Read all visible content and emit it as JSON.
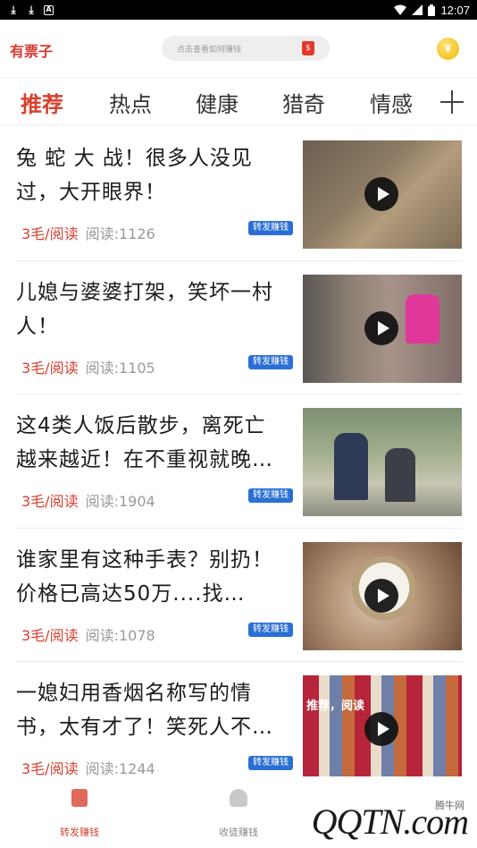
{
  "status_bar": {
    "icons": [
      "download-icon",
      "download-icon",
      "app-notification-icon",
      "wifi-icon",
      "signal-icon",
      "battery-icon"
    ],
    "time": "12:07"
  },
  "header": {
    "brand": "有票子",
    "search_placeholder": "点击查看如何赚钱",
    "coin_symbol": "¥"
  },
  "tabs": [
    {
      "label": "推荐",
      "active": true
    },
    {
      "label": "热点"
    },
    {
      "label": "健康"
    },
    {
      "label": "猎奇"
    },
    {
      "label": "情感"
    }
  ],
  "feed": [
    {
      "title": "兔 蛇 大 战！很多人没见过，大开眼界！",
      "reward": "3毛/阅读",
      "reads": "阅读:1126",
      "badge": "转发赚钱"
    },
    {
      "title": "儿媳与婆婆打架，笑坏一村人！",
      "reward": "3毛/阅读",
      "reads": "阅读:1105",
      "badge": "转发赚钱"
    },
    {
      "title": "这4类人饭后散步，离死亡越来越近！在不重视就晚…",
      "reward": "3毛/阅读",
      "reads": "阅读:1904",
      "badge": "转发赚钱"
    },
    {
      "title": "谁家里有这种手表？别扔！价格已高达50万....找…",
      "reward": "3毛/阅读",
      "reads": "阅读:1078",
      "badge": "转发赚钱"
    },
    {
      "title": "一媳妇用香烟名称写的情书，太有才了！笑死人不…",
      "reward": "3毛/阅读",
      "reads": "阅读:1244",
      "badge": "转发赚钱",
      "thumb_text": "推荐，阅读"
    }
  ],
  "bottom_nav": [
    {
      "label": "转发赚钱",
      "active": true
    },
    {
      "label": "收徒赚钱"
    }
  ],
  "watermark": {
    "text": "腾牛网",
    "logo": "QQTN.com"
  },
  "colors": {
    "accent": "#d8402f",
    "badge": "#2b6fd6",
    "muted": "#9a9a9a"
  }
}
